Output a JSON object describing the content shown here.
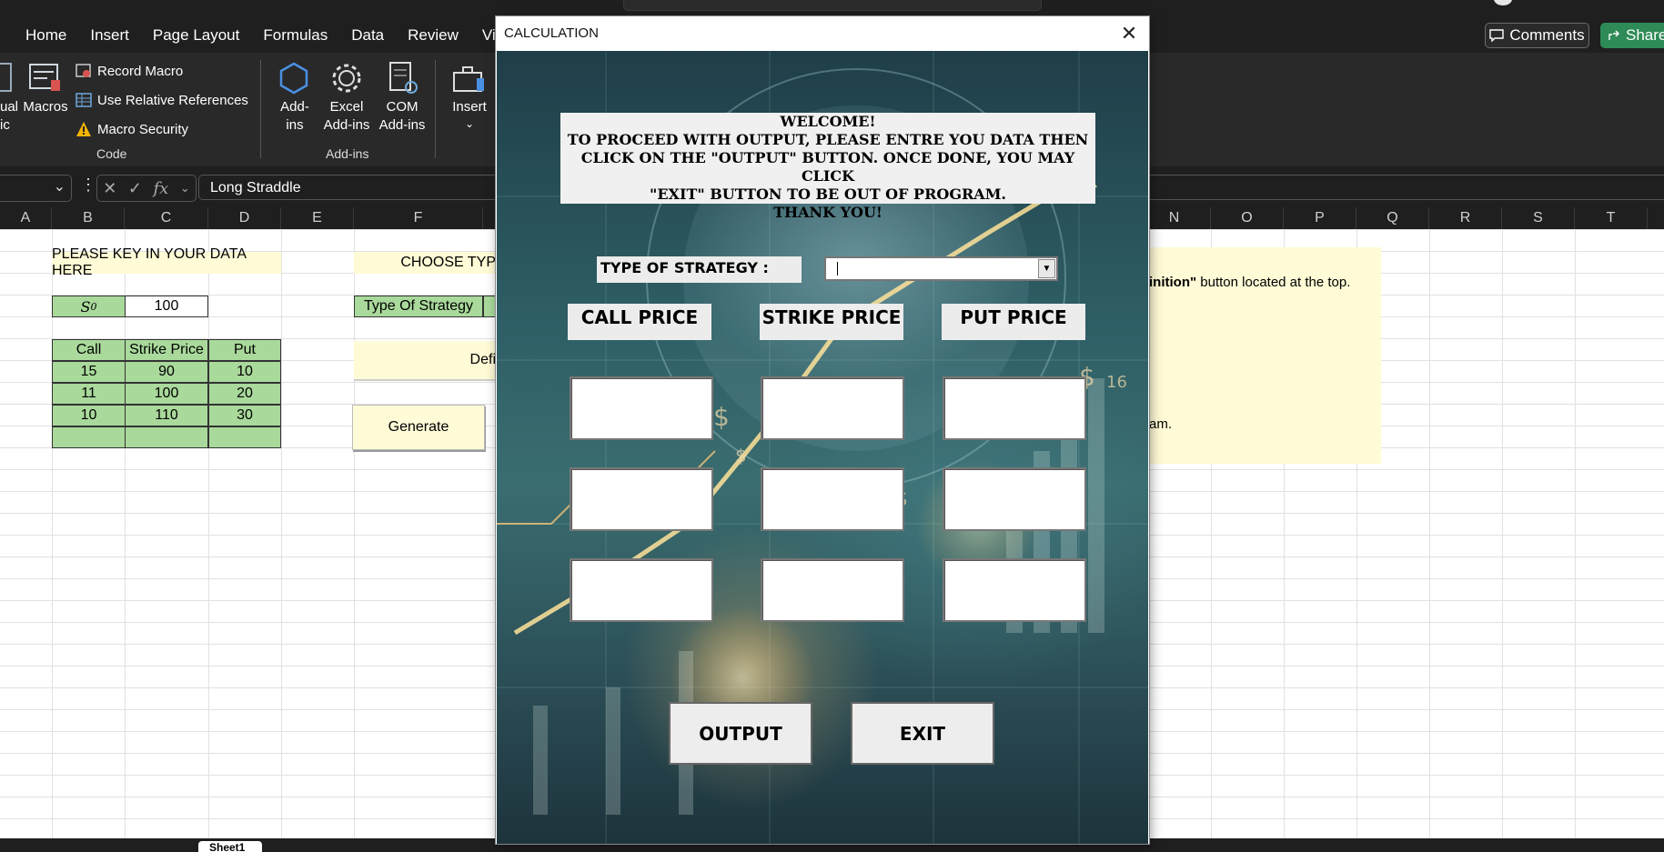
{
  "ribbon_tabs": [
    "Home",
    "Insert",
    "Page Layout",
    "Formulas",
    "Data",
    "Review",
    "Vie"
  ],
  "top_right": {
    "comments": "Comments",
    "share": "Share"
  },
  "ribbon": {
    "code_group": {
      "visual_basic_partial": "ual\nic",
      "macros": "Macros",
      "record_macro": "Record Macro",
      "use_relative": "Use Relative References",
      "macro_security": "Macro Security",
      "group_label": "Code"
    },
    "addins_group": {
      "addins": "Add-\nins",
      "excel_addins": "Excel\nAdd-ins",
      "com_addins": "COM\nAdd-ins",
      "group_label": "Add-ins"
    },
    "controls_group": {
      "insert": "Insert"
    }
  },
  "formula_bar": {
    "value": "Long Straddle",
    "fx": "fx"
  },
  "columns": [
    "A",
    "B",
    "C",
    "D",
    "E",
    "F",
    "N",
    "O",
    "P",
    "Q",
    "R",
    "S",
    "T"
  ],
  "sheet": {
    "banner": "PLEASE KEY IN YOUR DATA HERE",
    "choose_partial": "CHOOSE TYP",
    "s0_label": "S",
    "s0_sub": "0",
    "s0_value": "100",
    "type_of_strategy": "Type Of Strategy",
    "table_headers": [
      "Call",
      "Strike Price",
      "Put"
    ],
    "table_rows": [
      [
        "15",
        "90",
        "10"
      ],
      [
        "11",
        "100",
        "20"
      ],
      [
        "10",
        "110",
        "30"
      ]
    ],
    "definition_partial": "Defi",
    "generate": "Generate",
    "note1_bold": "inition\"",
    "note1_rest": " button located at the top.",
    "note2": "am."
  },
  "sheet_tab": "Sheet1",
  "dialog": {
    "title": "CALCULATION",
    "close": "✕",
    "welcome": "WELCOME!\nTO PROCEED WITH OUTPUT, PLEASE ENTRE YOU DATA THEN\nCLICK ON THE \"OUTPUT\" BUTTON. ONCE DONE, YOU MAY CLICK\n\"EXIT\" BUTTON TO BE OUT OF PROGRAM.\nTHANK YOU!",
    "strategy_label": "TYPE OF STRATEGY :",
    "strategy_value": "",
    "call_price": "CALL PRICE",
    "strike_price": "STRIKE PRICE",
    "put_price": "PUT PRICE",
    "output_button": "OUTPUT",
    "exit_button": "EXIT"
  }
}
